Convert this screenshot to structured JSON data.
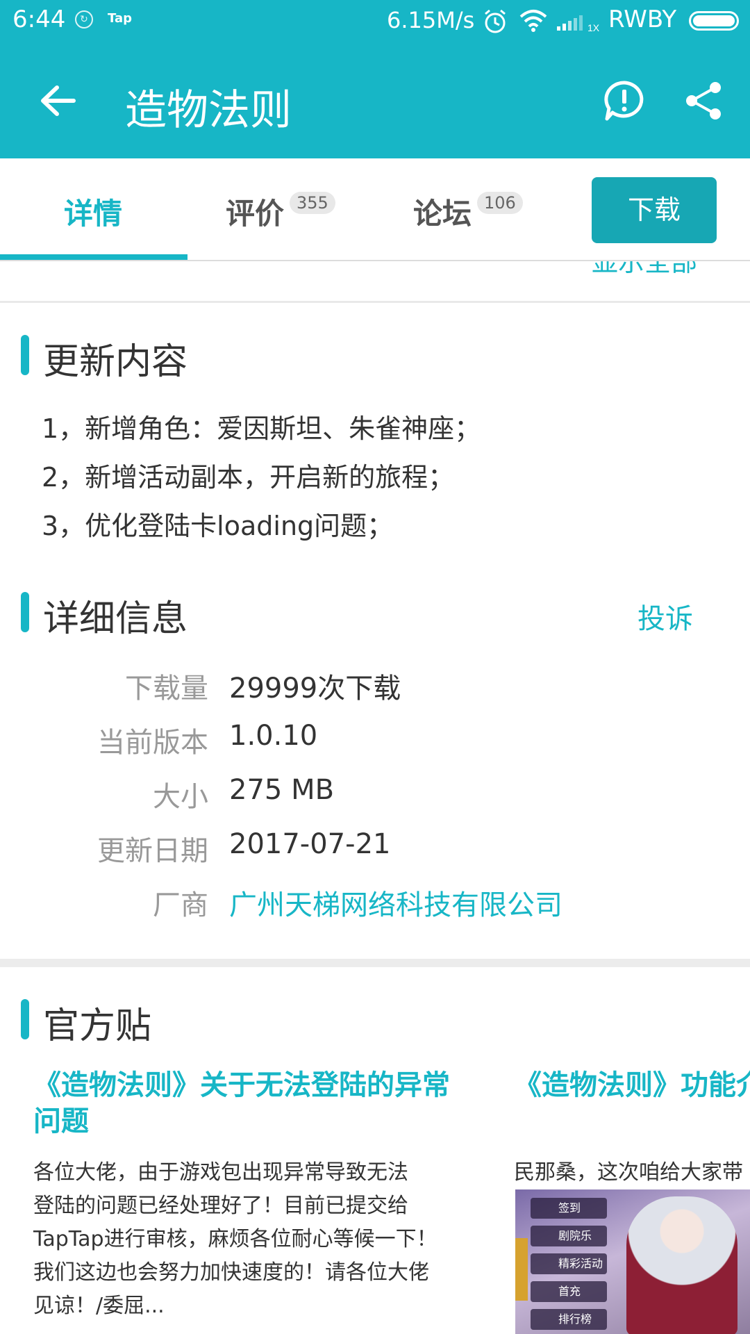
{
  "status_bar": {
    "time": "6:44",
    "app_icon_2": "Tap",
    "net_speed": "6.15M/s",
    "carrier": "RWBY",
    "icons": [
      "app-icon",
      "alarm-icon",
      "wifi-icon",
      "signal-icon",
      "battery-icon"
    ]
  },
  "app_bar": {
    "title": "造物法则",
    "icons": [
      "back-arrow-icon",
      "report-icon",
      "share-icon"
    ]
  },
  "tabs": [
    {
      "label": "详情",
      "badge": "",
      "active": true
    },
    {
      "label": "评价",
      "badge": "355",
      "active": false
    },
    {
      "label": "论坛",
      "badge": "106",
      "active": false
    }
  ],
  "download_label": "下载",
  "show_all": "显示全部",
  "update": {
    "title": "更新内容",
    "items": [
      "1，新增角色：爱因斯坦、朱雀神座；",
      "2，新增活动副本，开启新的旅程；",
      "3，优化登陆卡loading问题；"
    ]
  },
  "details": {
    "title": "详细信息",
    "complain": "投诉",
    "rows": [
      {
        "label": "下载量",
        "value": "29999次下载"
      },
      {
        "label": "当前版本",
        "value": "1.0.10"
      },
      {
        "label": "大小",
        "value": "275 MB"
      },
      {
        "label": "更新日期",
        "value": "2017-07-21"
      },
      {
        "label": "厂商",
        "value": "广州天梯网络科技有限公司"
      }
    ]
  },
  "official": {
    "title": "官方贴",
    "posts": [
      {
        "title_line1": "《造物法则》关于无法登陆的异常",
        "title_line2": "问题",
        "body": [
          "各位大佬，由于游戏包出现异常导致无法",
          "登陆的问题已经处理好了！目前已提交给",
          "TapTap进行审核，麻烦各位耐心等候一下！",
          "我们这边也会努力加快速度的！请各位大佬",
          "见谅！/委屈..."
        ]
      },
      {
        "title_line1": "《造物法则》功能介",
        "body": [
          "民那桑，这次咱给大家带"
        ],
        "image_menu": [
          "签到",
          "剧院乐",
          "精彩活动",
          "首充",
          "排行榜"
        ]
      }
    ]
  },
  "colors": {
    "accent": "#17b6c6",
    "download_button": "#17a7b4"
  }
}
